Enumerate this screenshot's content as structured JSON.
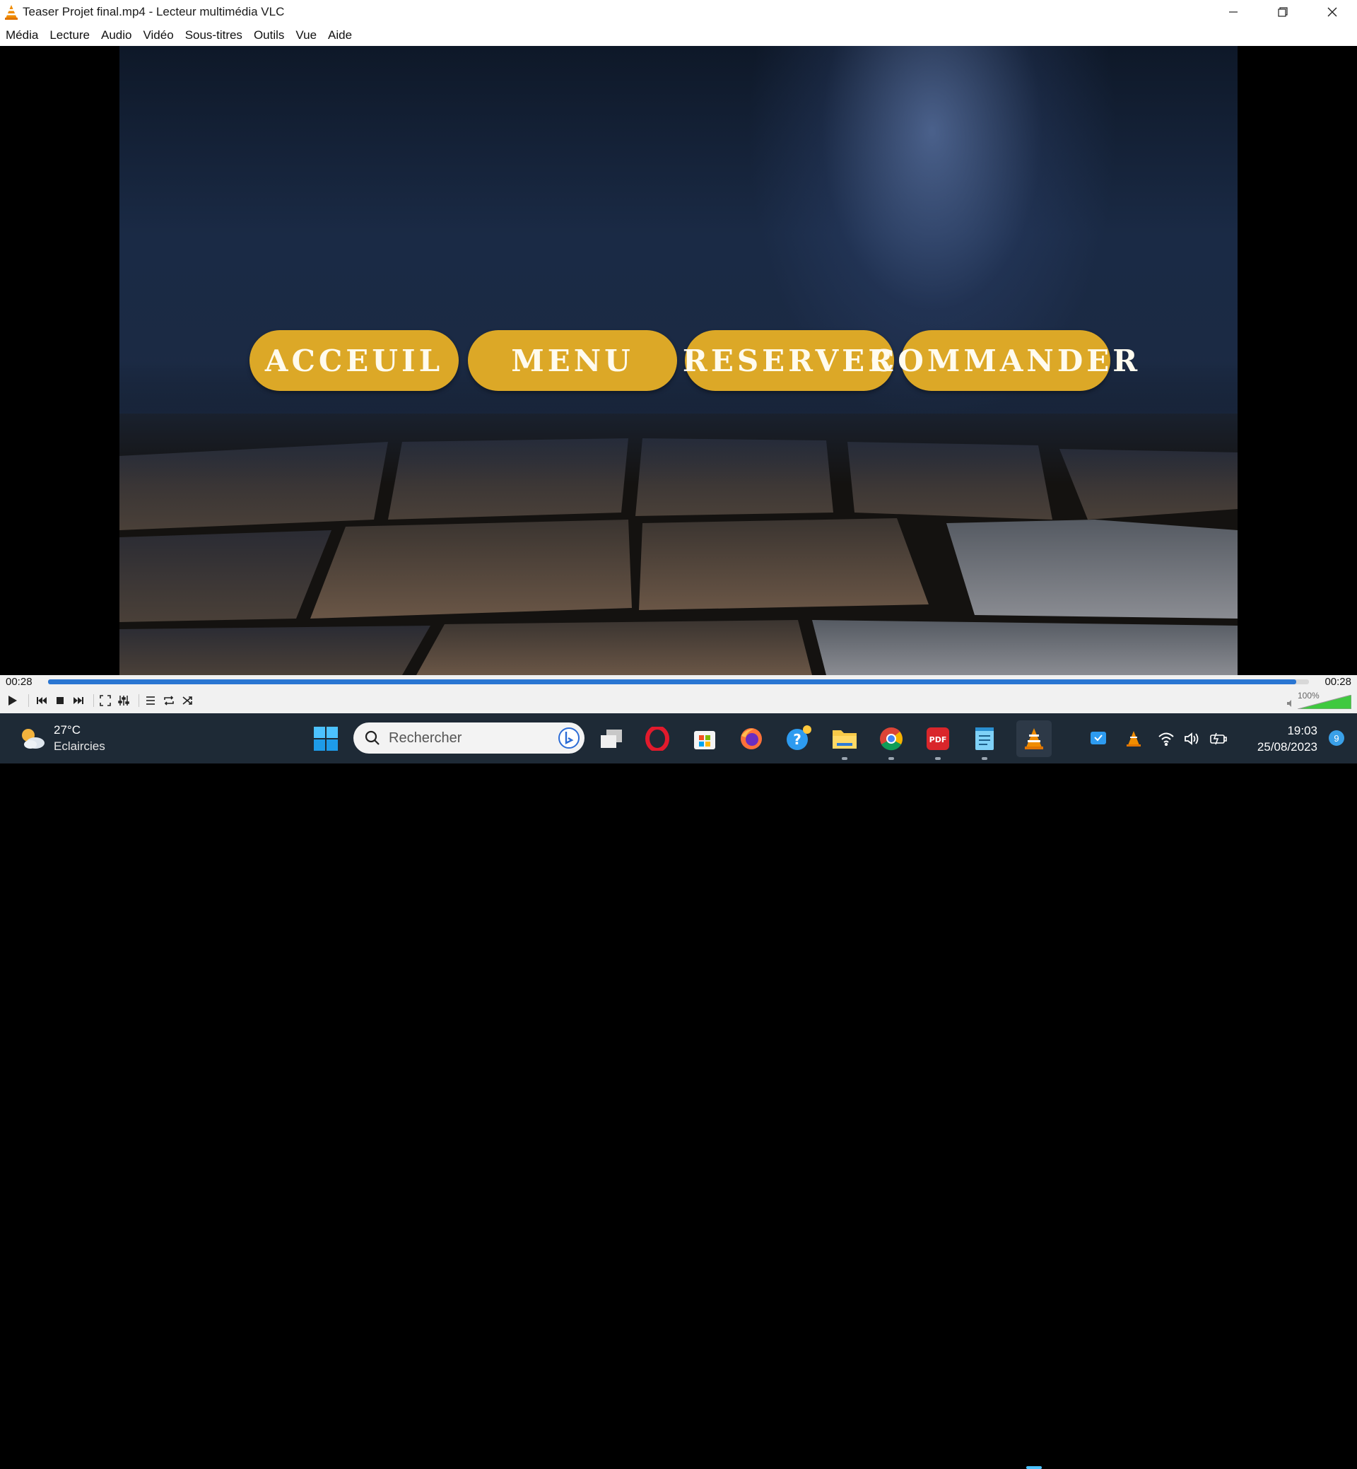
{
  "window": {
    "title": "Teaser Projet final.mp4 - Lecteur multimédia VLC",
    "controls": [
      "minimize",
      "restore",
      "close"
    ]
  },
  "menu": {
    "items": [
      "Média",
      "Lecture",
      "Audio",
      "Vidéo",
      "Sous-titres",
      "Outils",
      "Vue",
      "Aide"
    ]
  },
  "video": {
    "buttons": [
      "ACCEUIL",
      "MENU",
      "RESERVER",
      "COMMANDER"
    ],
    "button_color": "#dca827"
  },
  "playback": {
    "elapsed": "00:28",
    "total": "00:28",
    "progress_fraction": 0.99,
    "volume_label": "100%",
    "volume_fraction": 1.0,
    "accent": "#2a76d2"
  },
  "taskbar": {
    "weather": {
      "temp": "27°C",
      "condition": "Eclaircies"
    },
    "search_placeholder": "Rechercher",
    "time": "19:03",
    "date": "25/08/2023",
    "notifications": "9"
  }
}
